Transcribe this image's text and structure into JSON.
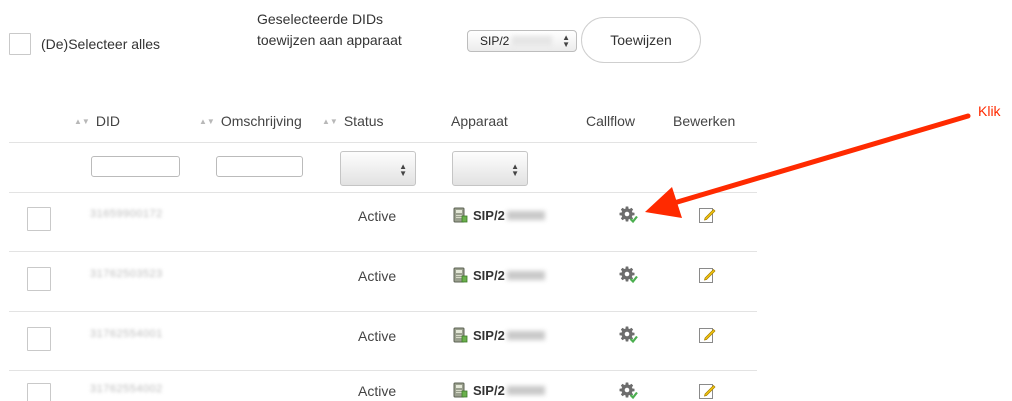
{
  "toolbar": {
    "select_all_label": "(De)Selecteer alles",
    "assign_label_line1": "Geselecteerde DIDs",
    "assign_label_line2": "toewijzen aan apparaat",
    "device_select_value": "SIP/2",
    "assign_button_label": "Toewijzen"
  },
  "table": {
    "columns": [
      {
        "key": "did",
        "label": "DID",
        "sortable": true
      },
      {
        "key": "description",
        "label": "Omschrijving",
        "sortable": true
      },
      {
        "key": "status",
        "label": "Status",
        "sortable": true
      },
      {
        "key": "device",
        "label": "Apparaat",
        "sortable": false
      },
      {
        "key": "callflow",
        "label": "Callflow",
        "sortable": false
      },
      {
        "key": "edit",
        "label": "Bewerken",
        "sortable": false
      }
    ],
    "rows": [
      {
        "did": "31659900172",
        "status": "Active",
        "device": "SIP/2"
      },
      {
        "did": "31762503523",
        "status": "Active",
        "device": "SIP/2"
      },
      {
        "did": "31762554001",
        "status": "Active",
        "device": "SIP/2"
      },
      {
        "did": "31762554002",
        "status": "Active",
        "device": "SIP/2"
      }
    ]
  },
  "annotation": {
    "text": "Klik",
    "color": "#ff2a00"
  },
  "icons": {
    "callflow": "gear-icon",
    "edit": "edit-icon",
    "device": "device-icon"
  }
}
